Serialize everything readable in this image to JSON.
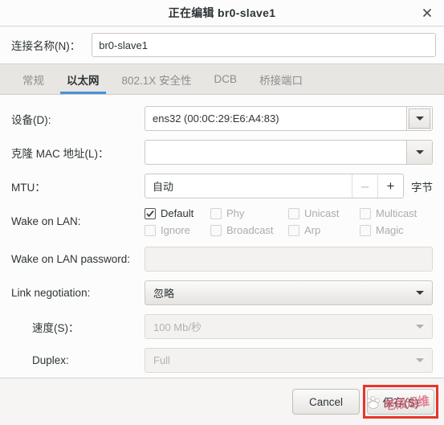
{
  "window": {
    "title": "正在编辑  br0-slave1",
    "close_icon": "close-icon"
  },
  "connection": {
    "label": "连接名称(N)：",
    "value": "br0-slave1",
    "placeholder": ""
  },
  "tabs": [
    {
      "label": "常规",
      "active": false
    },
    {
      "label": "以太网",
      "active": true
    },
    {
      "label": "802.1X 安全性",
      "active": false
    },
    {
      "label": "DCB",
      "active": false
    },
    {
      "label": "桥接端口",
      "active": false
    }
  ],
  "form": {
    "device": {
      "label": "设备(D):",
      "value": "ens32 (00:0C:29:E6:A4:83)"
    },
    "cloned_mac": {
      "label": "克隆 MAC 地址(L)：",
      "value": ""
    },
    "mtu": {
      "label": "MTU：",
      "value": "自动",
      "minus": "–",
      "plus": "+",
      "unit": "字节"
    },
    "wake_on_lan": {
      "label": "Wake on LAN:",
      "options": [
        {
          "label": "Default",
          "checked": true,
          "disabled": false
        },
        {
          "label": "Phy",
          "checked": false,
          "disabled": true
        },
        {
          "label": "Unicast",
          "checked": false,
          "disabled": true
        },
        {
          "label": "Multicast",
          "checked": false,
          "disabled": true
        },
        {
          "label": "Ignore",
          "checked": false,
          "disabled": true
        },
        {
          "label": "Broadcast",
          "checked": false,
          "disabled": true
        },
        {
          "label": "Arp",
          "checked": false,
          "disabled": true
        },
        {
          "label": "Magic",
          "checked": false,
          "disabled": true
        }
      ]
    },
    "wol_password": {
      "label": "Wake on LAN password:",
      "value": ""
    },
    "link_negotiation": {
      "label": "Link negotiation:",
      "value": "忽略"
    },
    "speed": {
      "label": "速度(S)：",
      "value": "100 Mb/秒"
    },
    "duplex": {
      "label": "Duplex:",
      "value": "Full"
    }
  },
  "footer": {
    "cancel": "Cancel",
    "save": "保存(S)"
  },
  "watermark": {
    "text": "老段运维",
    "logo_icon": "paw-logo-icon"
  },
  "colors": {
    "accent": "#4a90d9",
    "highlight": "#e8342b",
    "dialog_bg": "#f6f5f4",
    "panel_bg": "#fcfcfc"
  }
}
